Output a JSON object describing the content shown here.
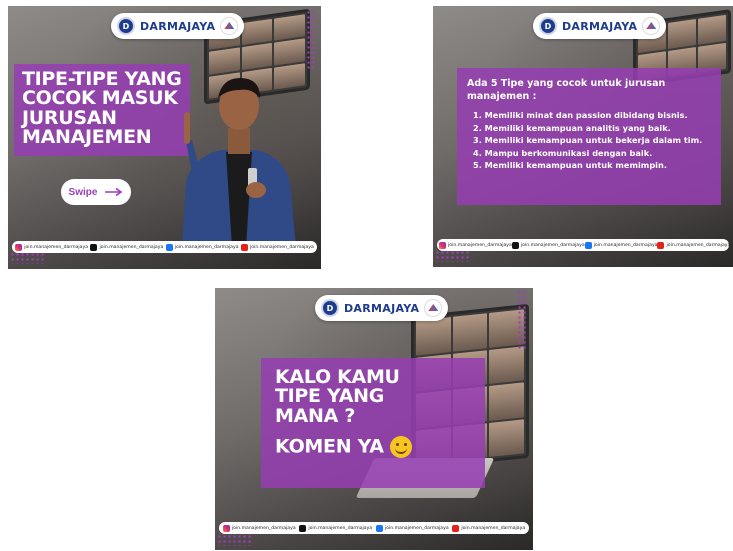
{
  "brand": {
    "name": "DARMAJAYA"
  },
  "footer": {
    "handles": [
      {
        "icon": "instagram-icon",
        "text": "join.manajemen_darmajaya"
      },
      {
        "icon": "tiktok-icon",
        "text": "join.manajemen_darmajaya"
      },
      {
        "icon": "facebook-icon",
        "text": "join.manajemen_darmajaya"
      },
      {
        "icon": "youtube-icon",
        "text": "join.manajemen_darmajaya"
      }
    ]
  },
  "post1": {
    "headline_lines": [
      "TIPE-TIPE YANG",
      "COCOK MASUK",
      "JURUSAN",
      "MANAJEMEN"
    ],
    "swipe_label": "Swipe",
    "swipe_icon": "arrow-right-icon"
  },
  "post2": {
    "intro_lines": [
      "Ada 5 Tipe yang cocok untuk jurusan",
      "manajemen :"
    ],
    "items": [
      "1. Memiliki minat dan passion dibidang bisnis.",
      "2. Memiliki kemampuan analitis yang baik.",
      "3.  Memiliki kemampuan untuk bekerja dalam tim.",
      "4. Mampu berkomunikasi dengan baik.",
      "5. Memiliki kemampuan untuk memimpin."
    ]
  },
  "post3": {
    "question_lines": [
      "KALO KAMU",
      "TIPE YANG",
      "MANA ?"
    ],
    "cta": "KOMEN YA",
    "cta_icon": "smiley-icon"
  },
  "colors": {
    "accent_purple": "#963eb2",
    "brand_blue": "#1e3c8c",
    "white": "#ffffff"
  }
}
